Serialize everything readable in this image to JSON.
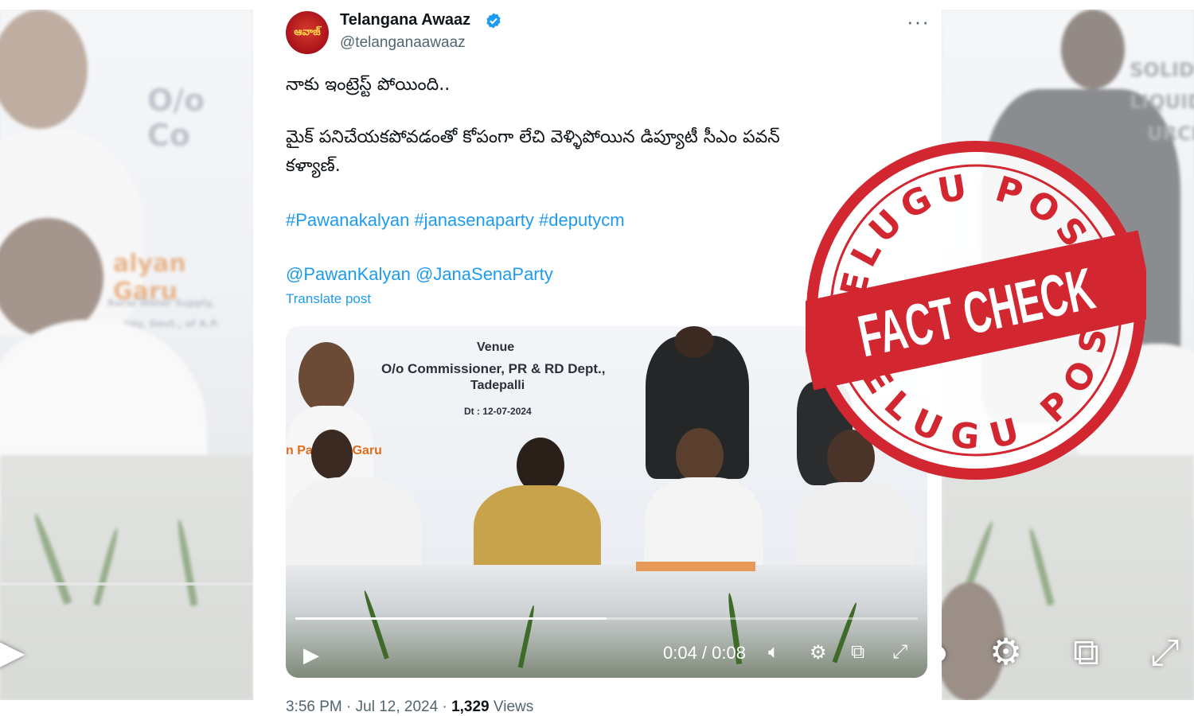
{
  "tweet": {
    "name": "Telangana Awaaz",
    "handle": "@telanganaawaaz",
    "avatar_text": "ఆవాజ్",
    "line1": "నాకు ఇంట్రెస్ట్ పోయింది..",
    "line2": "మైక్ పనిచేయకపోవడంతో కోపంగా లేచి వెళ్ళిపోయిన డిప్యూటీ సీఎం పవన్",
    "line3": "కళ్యాణ్.",
    "hashtags": "#Pawanakalyan #janasenaparty #deputycm",
    "mentions": "@PawanKalyan @JanaSenaParty",
    "translate": "Translate post",
    "time": "3:56 PM · Jul 12, 2024 · ",
    "views_count": "1,329",
    "views_label": " Views"
  },
  "video": {
    "venue": "Venue",
    "office": "O/o Commissioner, PR & RD Dept.,",
    "place": "Tadepalli",
    "date": "Dt : 12-07-2024",
    "banner_name": "n Pa     alyan Garu",
    "timecode": "0:04 / 0:08",
    "progress": 0.5
  },
  "left_panel": {
    "text1": "O/o Co",
    "text2": "alyan Garu",
    "text3": "Rural Water Supply,",
    "text4": "ogy, Govt., of A.P."
  },
  "right_panel": {
    "text1": "SOLID",
    "text2": "LIQUID",
    "text3": "URCE"
  },
  "stamp": {
    "top_text": "TELUGU POST",
    "bottom_text": "TELUGU POST",
    "center_text": "FACT CHECK",
    "color": "#d22630"
  }
}
